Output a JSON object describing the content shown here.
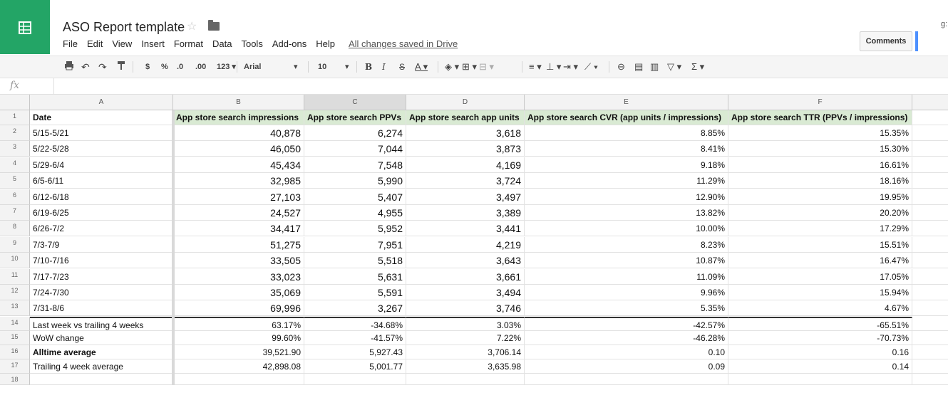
{
  "header": {
    "title": "ASO Report template",
    "menu": [
      "File",
      "Edit",
      "View",
      "Insert",
      "Format",
      "Data",
      "Tools",
      "Add-ons",
      "Help"
    ],
    "save_status": "All changes saved in Drive",
    "comments_label": "Comments",
    "user_fragment": "g:"
  },
  "toolbar": {
    "currency": "$",
    "percent": "%",
    "decrease_decimals": ".0",
    "increase_decimals": ".00",
    "more_formats": "123",
    "font": "Arial",
    "font_size": "10",
    "bold": "B",
    "italic": "I",
    "strikethrough": "S",
    "text_color": "A",
    "sigma": "Σ"
  },
  "formula_bar": {
    "fx": "fx"
  },
  "sheet": {
    "columns": [
      "A",
      "B",
      "C",
      "D",
      "E",
      "F"
    ],
    "row_numbers": [
      "1",
      "2",
      "3",
      "4",
      "5",
      "6",
      "7",
      "8",
      "9",
      "10",
      "11",
      "12",
      "13",
      "14",
      "15",
      "16",
      "17",
      "18"
    ],
    "header_row": [
      "Date",
      "App store search impressions",
      "App store search PPVs",
      "App store search app units",
      "App store search CVR (app units / impressions)",
      "App store search TTR (PPVs / impressions)"
    ],
    "rows": [
      [
        "5/15-5/21",
        "40,878",
        "6,274",
        "3,618",
        "8.85%",
        "15.35%"
      ],
      [
        "5/22-5/28",
        "46,050",
        "7,044",
        "3,873",
        "8.41%",
        "15.30%"
      ],
      [
        "5/29-6/4",
        "45,434",
        "7,548",
        "4,169",
        "9.18%",
        "16.61%"
      ],
      [
        "6/5-6/11",
        "32,985",
        "5,990",
        "3,724",
        "11.29%",
        "18.16%"
      ],
      [
        "6/12-6/18",
        "27,103",
        "5,407",
        "3,497",
        "12.90%",
        "19.95%"
      ],
      [
        "6/19-6/25",
        "24,527",
        "4,955",
        "3,389",
        "13.82%",
        "20.20%"
      ],
      [
        "6/26-7/2",
        "34,417",
        "5,952",
        "3,441",
        "10.00%",
        "17.29%"
      ],
      [
        "7/3-7/9",
        "51,275",
        "7,951",
        "4,219",
        "8.23%",
        "15.51%"
      ],
      [
        "7/10-7/16",
        "33,505",
        "5,518",
        "3,643",
        "10.87%",
        "16.47%"
      ],
      [
        "7/17-7/23",
        "33,023",
        "5,631",
        "3,661",
        "11.09%",
        "17.05%"
      ],
      [
        "7/24-7/30",
        "35,069",
        "5,591",
        "3,494",
        "9.96%",
        "15.94%"
      ],
      [
        "7/31-8/6",
        "69,996",
        "3,267",
        "3,746",
        "5.35%",
        "4.67%"
      ]
    ],
    "summary_rows": [
      [
        "Last week vs trailing 4 weeks",
        "63.17%",
        "-34.68%",
        "3.03%",
        "-42.57%",
        "-65.51%"
      ],
      [
        "WoW change",
        "99.60%",
        "-41.57%",
        "7.22%",
        "-46.28%",
        "-70.73%"
      ],
      [
        "Alltime average",
        "39,521.90",
        "5,927.43",
        "3,706.14",
        "0.10",
        "0.16"
      ],
      [
        "Trailing 4 week average",
        "42,898.08",
        "5,001.77",
        "3,635.98",
        "0.09",
        "0.14"
      ]
    ]
  },
  "colors": {
    "sheets_green": "#23a566",
    "header_fill": "#d9ead3",
    "share_blue": "#4d90fe"
  }
}
